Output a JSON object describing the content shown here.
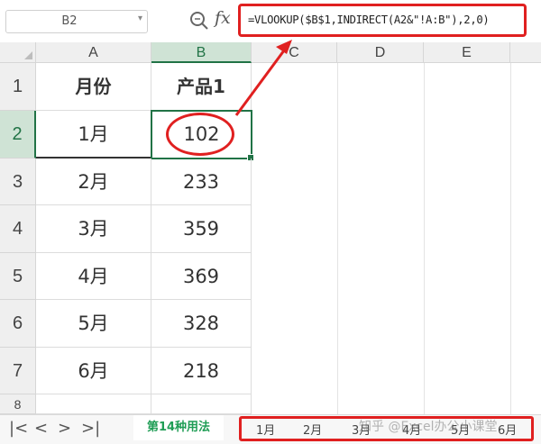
{
  "formula_bar": {
    "name_box": "B2",
    "fx_label": "fx",
    "formula": "=VLOOKUP($B$1,INDIRECT(A2&\"!A:B\"),2,0)"
  },
  "columns": [
    "A",
    "B",
    "C",
    "D",
    "E"
  ],
  "rows": [
    "1",
    "2",
    "3",
    "4",
    "5",
    "6",
    "7",
    "8"
  ],
  "table": {
    "header": {
      "month": "月份",
      "product": "产品1"
    },
    "rows": [
      {
        "month": "1月",
        "value": "102"
      },
      {
        "month": "2月",
        "value": "233"
      },
      {
        "month": "3月",
        "value": "359"
      },
      {
        "month": "4月",
        "value": "369"
      },
      {
        "month": "5月",
        "value": "328"
      },
      {
        "month": "6月",
        "value": "218"
      }
    ]
  },
  "active_cell": "B2",
  "sheet_tabs": {
    "active": "第14种用法",
    "others": [
      "1月",
      "2月",
      "3月",
      "4月",
      "5月",
      "6月"
    ]
  },
  "watermark": "知乎 @Excel办公小课堂",
  "colors": {
    "accent_green": "#217346",
    "annotation_red": "#e02020",
    "tab_green": "#1f9d55"
  }
}
